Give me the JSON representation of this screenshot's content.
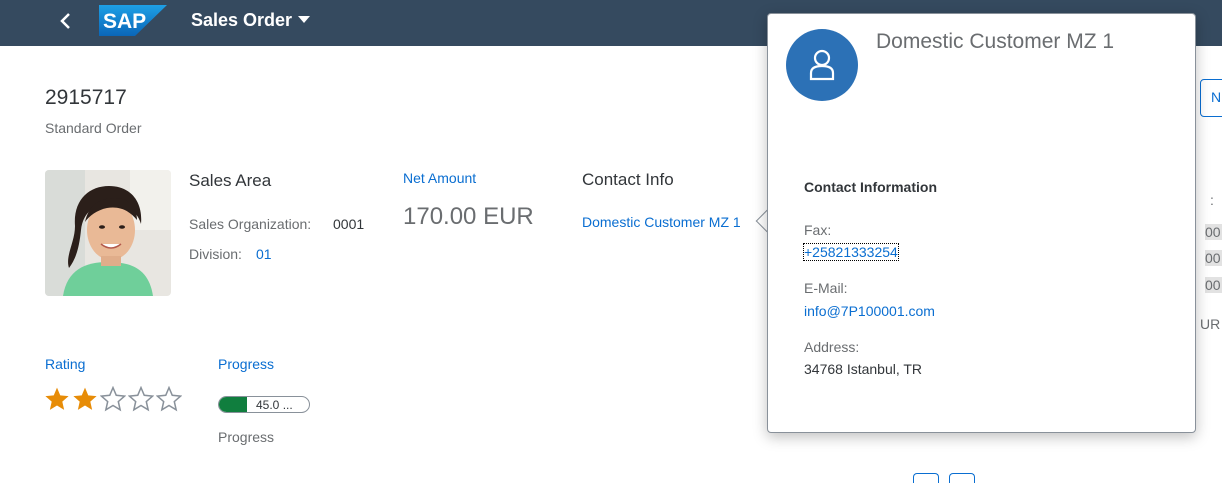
{
  "shell": {
    "logo_text": "SAP",
    "app_title": "Sales Order",
    "colors": {
      "shell_bg": "#354a5f",
      "logo_blue": "#0a75c9"
    }
  },
  "header": {
    "object_id": "2915717",
    "object_subtitle": "Standard Order"
  },
  "sales_area": {
    "title": "Sales Area",
    "org_label": "Sales Organization:",
    "org_value": "0001",
    "division_label": "Division:",
    "division_value": "01"
  },
  "net_amount": {
    "label": "Net Amount",
    "value": "170.00 EUR"
  },
  "contact_info": {
    "title": "Contact Info",
    "link": "Domestic Customer MZ 1"
  },
  "rating": {
    "label": "Rating",
    "value": 2,
    "max": 5,
    "colors": {
      "filled": "#e78c07",
      "empty": "#89919a"
    }
  },
  "progress": {
    "label": "Progress",
    "value_percent": 45,
    "display_text": "45.0 ...",
    "caption": "Progress",
    "colors": {
      "fill": "#107e3e"
    }
  },
  "background_right": {
    "button_text": "N",
    "frag_1": ":",
    "frag_2": "00",
    "frag_3": "00",
    "frag_4": "00",
    "frag_5": "UR"
  },
  "popover": {
    "title": "Domestic Customer MZ 1",
    "avatar_icon": "person-icon",
    "section_title": "Contact Information",
    "fax_label": "Fax:",
    "fax_value": "+25821333254",
    "email_label": "E-Mail:",
    "email_value": "info@7P100001.com",
    "address_label": "Address:",
    "address_value": "34768 Istanbul, TR",
    "colors": {
      "avatar_bg": "#2c71b6",
      "link": "#0a6ed1"
    }
  }
}
